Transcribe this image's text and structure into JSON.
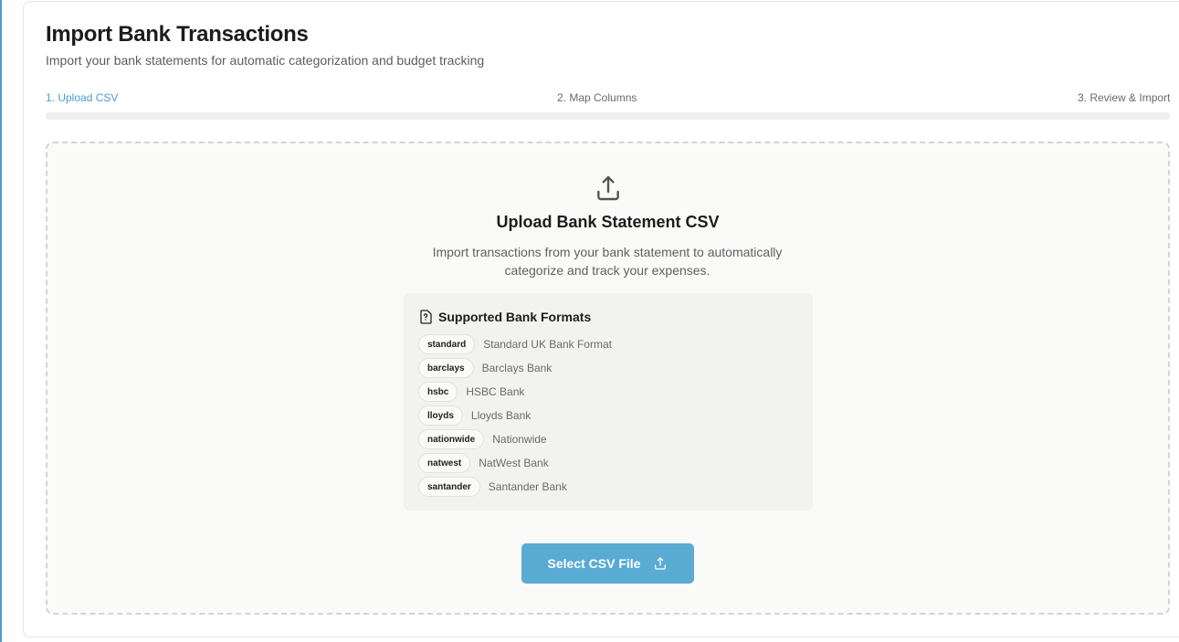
{
  "header": {
    "title": "Import Bank Transactions",
    "subtitle": "Import your bank statements for automatic categorization and budget tracking"
  },
  "steps": [
    {
      "label": "1. Upload CSV",
      "active": true
    },
    {
      "label": "2. Map Columns",
      "active": false
    },
    {
      "label": "3. Review & Import",
      "active": false
    }
  ],
  "progress": {
    "current_step": 1,
    "total_steps": 3
  },
  "dropzone": {
    "icon": "upload-icon",
    "title": "Upload Bank Statement CSV",
    "description": "Import transactions from your bank statement to automatically categorize and track your expenses."
  },
  "formats": {
    "icon": "file-question-icon",
    "title": "Supported Bank Formats",
    "items": [
      {
        "code": "standard",
        "name": "Standard UK Bank Format"
      },
      {
        "code": "barclays",
        "name": "Barclays Bank"
      },
      {
        "code": "hsbc",
        "name": "HSBC Bank"
      },
      {
        "code": "lloyds",
        "name": "Lloyds Bank"
      },
      {
        "code": "nationwide",
        "name": "Nationwide"
      },
      {
        "code": "natwest",
        "name": "NatWest Bank"
      },
      {
        "code": "santander",
        "name": "Santander Bank"
      }
    ]
  },
  "action": {
    "label": "Select CSV File",
    "icon": "upload-icon"
  },
  "colors": {
    "accent": "#4a9dcc",
    "button": "#5aabd4",
    "text": "#1c1c1c",
    "muted": "#5f5f5f"
  }
}
